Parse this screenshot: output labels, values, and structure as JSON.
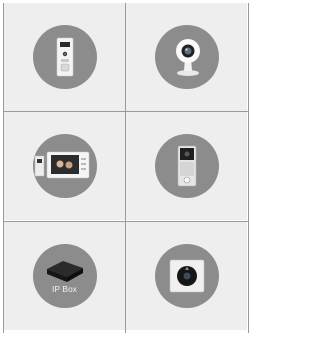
{
  "grid": {
    "cells": [
      {
        "icon": "doorbell-panel-icon"
      },
      {
        "icon": "ip-camera-icon"
      },
      {
        "icon": "video-intercom-monitor-icon"
      },
      {
        "icon": "video-doorbell-icon"
      },
      {
        "icon": "ip-box-icon",
        "label": "IP Box"
      },
      {
        "icon": "peephole-viewer-icon"
      }
    ]
  },
  "colors": {
    "circle": "#8c8c8c",
    "cell_background": "#eeeeee",
    "grid_lines": "#9a9a9a"
  }
}
